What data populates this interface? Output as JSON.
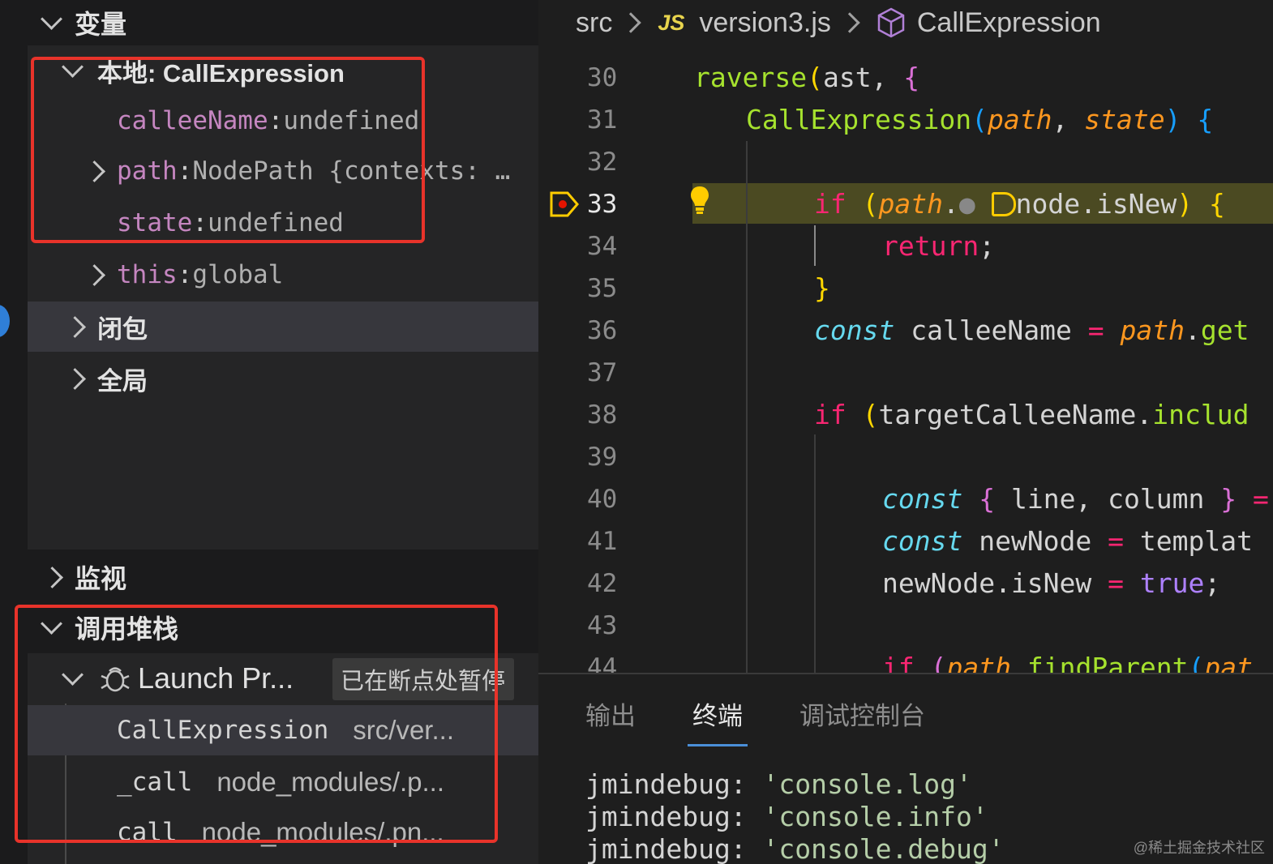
{
  "sidebar": {
    "variables_header": "变量",
    "local_scope": "本地: CallExpression",
    "vars": [
      {
        "name": "calleeName",
        "value": "undefined"
      },
      {
        "name": "path",
        "value": "NodePath {contexts: …"
      },
      {
        "name": "state",
        "value": "undefined"
      },
      {
        "name": "this",
        "value": "global"
      }
    ],
    "closure_scope": "闭包",
    "global_scope": "全局",
    "watch_header": "监视",
    "callstack_header": "调用堆栈",
    "launch_label": "Launch Pr...",
    "paused_badge": "已在断点处暂停",
    "frames": [
      {
        "fn": "CallExpression",
        "file": "src/ver..."
      },
      {
        "fn": "_call",
        "file": "node_modules/.p..."
      },
      {
        "fn": "call",
        "file": "node_modules/.pn..."
      }
    ]
  },
  "breadcrumb": {
    "folder": "src",
    "js_label": "JS",
    "file": "version3.js",
    "symbol": "CallExpression"
  },
  "editor": {
    "line_numbers": [
      "30",
      "31",
      "32",
      "33",
      "34",
      "35",
      "36",
      "37",
      "38",
      "39",
      "40",
      "41",
      "42",
      "43",
      "44"
    ],
    "current_line": "33"
  },
  "panel": {
    "tabs": [
      "输出",
      "终端",
      "调试控制台"
    ],
    "active_tab": "终端",
    "terminal_lines": [
      {
        "prefix": "jmindebug:",
        "value": "'console.log'"
      },
      {
        "prefix": "jmindebug:",
        "value": "'console.info'"
      },
      {
        "prefix": "jmindebug:",
        "value": "'console.debug'"
      }
    ]
  },
  "watermark": "@稀土掘金技术社区"
}
